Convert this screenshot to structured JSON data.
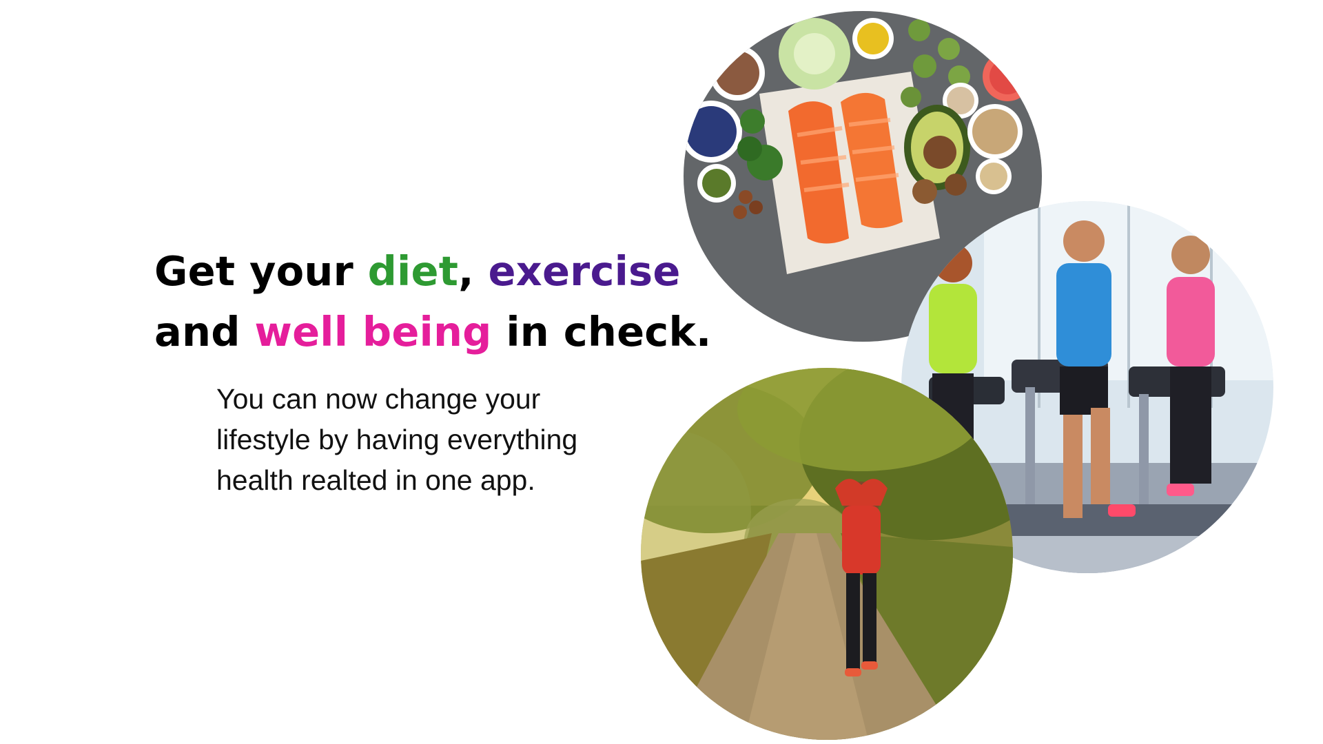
{
  "headline": {
    "line1_prefix": "Get your ",
    "diet": "diet",
    "comma": ", ",
    "exercise": "exercise",
    "line2_prefix": "and ",
    "well_being": "well being",
    "line2_suffix": " in check."
  },
  "subtext": {
    "line1": "You can now change your",
    "line2": "lifestyle by having everything",
    "line3": "health realted in one app."
  },
  "colors": {
    "diet": "#2e9a32",
    "exercise": "#4a1a8e",
    "well_being": "#e51e9b"
  },
  "images": {
    "food": "healthy-food-photo",
    "gym": "treadmill-workout-photo",
    "walk": "park-walk-photo"
  }
}
